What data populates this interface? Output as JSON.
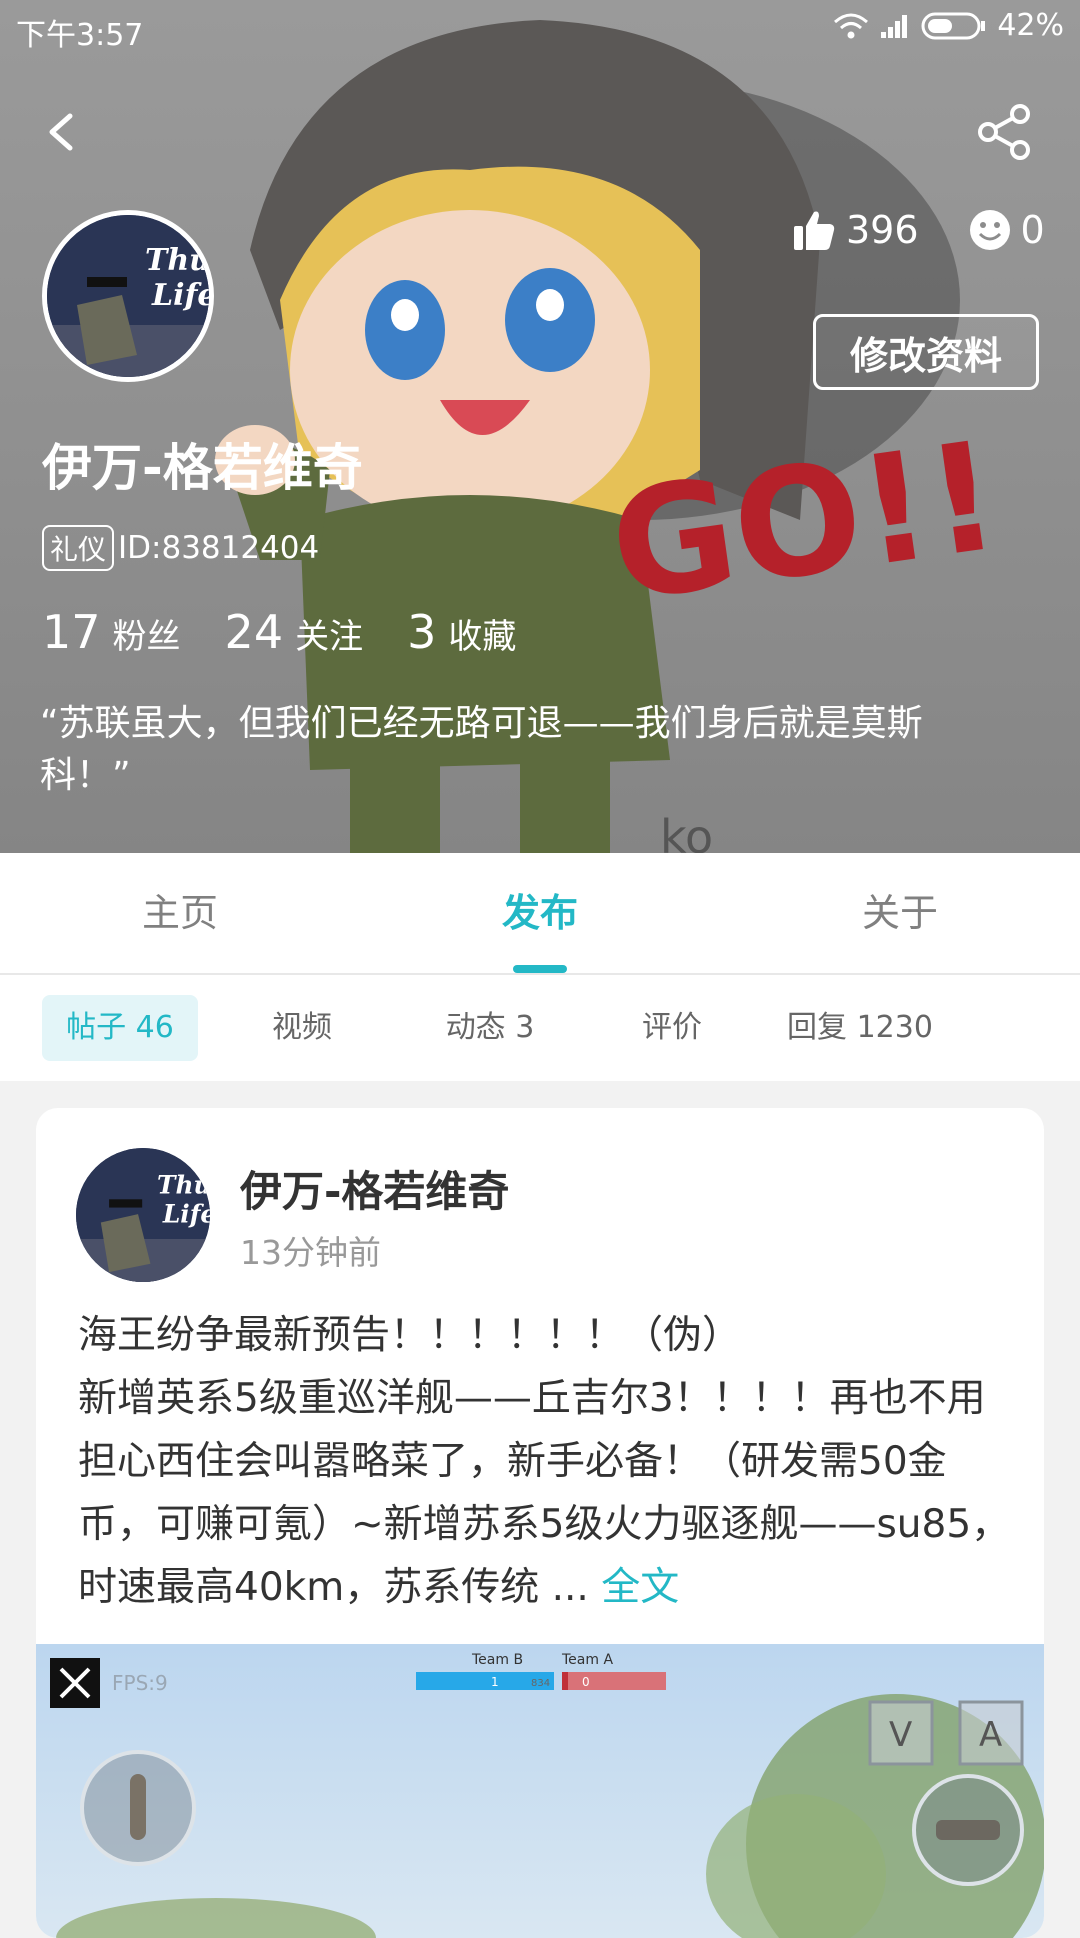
{
  "status_bar": {
    "time": "下午3:57",
    "battery": "42%"
  },
  "header": {
    "likes": "396",
    "smiles": "0",
    "edit_label": "修改资料",
    "username": "伊万-格若维奇",
    "tag": "礼仪",
    "id_text": "ID:83812404",
    "followers_count": "17",
    "followers_label": "粉丝",
    "following_count": "24",
    "following_label": "关注",
    "favorites_count": "3",
    "favorites_label": "收藏",
    "bio": "“苏联虽大，但我们已经无路可退——我们身后就是莫斯科！”",
    "avatar_text": [
      "Thug",
      "Life"
    ],
    "art_text": [
      "GO!!",
      "ko"
    ]
  },
  "main_tabs": [
    {
      "label": "主页"
    },
    {
      "label": "发布"
    },
    {
      "label": "关于"
    }
  ],
  "sub_tabs": [
    {
      "label": "帖子 46"
    },
    {
      "label": "视频"
    },
    {
      "label": "动态 3"
    },
    {
      "label": "评价"
    },
    {
      "label": "回复 1230"
    }
  ],
  "post": {
    "author": "伊万-格若维奇",
    "time": "13分钟前",
    "line1": "海王纷争最新预告！！！！！！（伪）",
    "line2": "新增英系5级重巡洋舰——丘吉尔3！！！！再也不用担心西住会叫嚣略菜了，新手必备！（研发需50金币，可赚可氪）~新增苏系5级火力驱逐舰——su85，时速最高40km，苏系传统 ...",
    "read_more": "全文",
    "image": {
      "fps": "FPS:9",
      "team_b": "Team B",
      "team_a": "Team A",
      "score_b": "1",
      "score_a": "0",
      "score_mid": "834",
      "btn_v": "V",
      "btn_a": "A"
    }
  },
  "colors": {
    "accent": "#23b8c6"
  },
  "icons": [
    "back-arrow-icon",
    "share-icon",
    "thumbs-up-icon",
    "smile-icon",
    "wifi-icon",
    "signal-icon",
    "battery-icon",
    "close-icon"
  ]
}
